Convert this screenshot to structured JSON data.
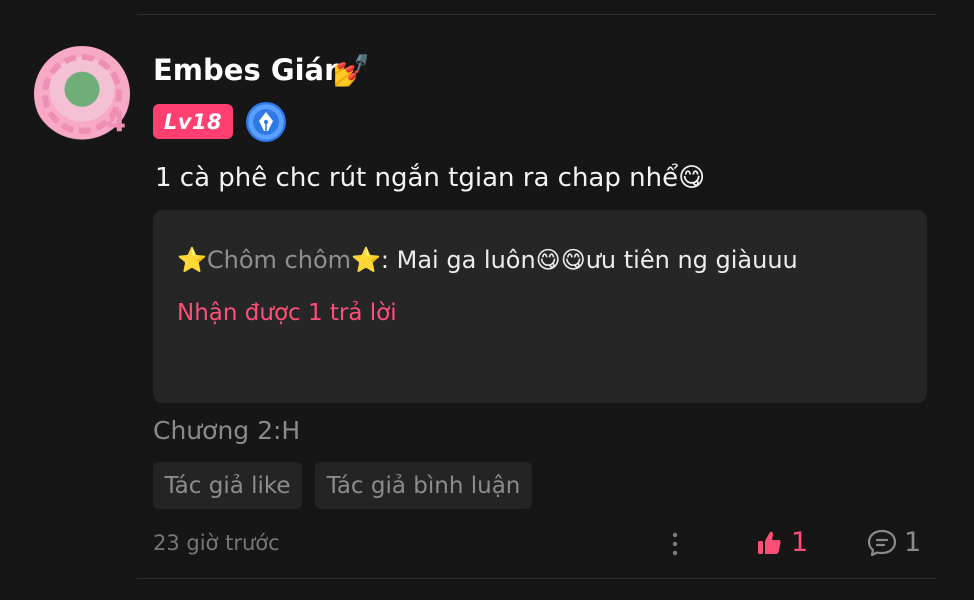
{
  "user": {
    "name": "Embes Gián",
    "name_emoji": "💅",
    "level": "Lv18",
    "avatar_text": "4"
  },
  "comment": {
    "text": "1 cà phê chc rút ngắn tgian ra chap nhể😋",
    "reply_preview": {
      "author": "⭐Chôm chôm⭐",
      "separator": ": ",
      "text": "Mai ga luôn😋😋ưu tiên ng giàuuu"
    },
    "reply_count_text": "Nhận được 1 trả lời",
    "chapter": "Chương 2:H",
    "chips": {
      "author_like": "Tác giả like",
      "author_reply": "Tác giả bình luận"
    },
    "time": "23 giờ trước",
    "like_count": "1",
    "reply_count": "1"
  },
  "colors": {
    "accent": "#ff4f79",
    "background": "#161616",
    "card": "#262626"
  },
  "icons": {
    "more": "more-vertical-icon",
    "like": "thumb-up-icon",
    "reply": "comment-bubble-icon",
    "badge": "pen-badge-icon"
  }
}
